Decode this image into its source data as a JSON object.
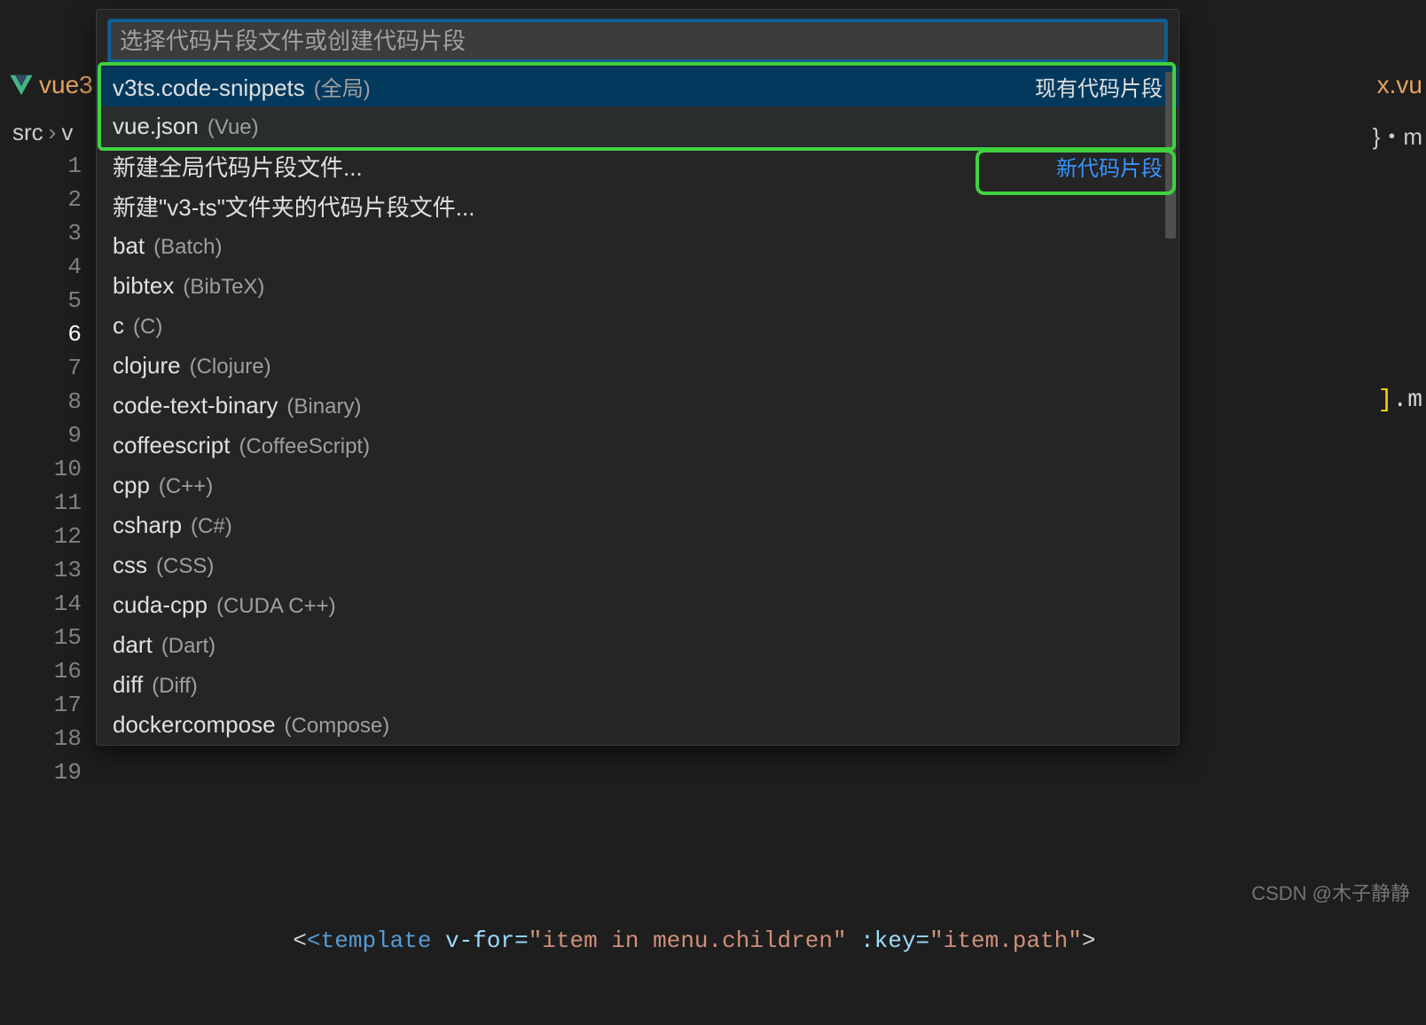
{
  "tab": {
    "label": "vue3",
    "right_label": "x.vu"
  },
  "breadcrumb": {
    "part1": "src",
    "part2": "v",
    "meta_right": "}・m"
  },
  "gutter": {
    "lines": 19,
    "active": 6
  },
  "picker": {
    "placeholder": "选择代码片段文件或创建代码片段",
    "section_existing_label": "现有代码片段",
    "section_new_label": "新代码片段",
    "items": [
      {
        "label": "v3ts.code-snippets",
        "hint": "(全局)",
        "selected": true,
        "badge": "existing"
      },
      {
        "label": "vue.json",
        "hint": "(Vue)",
        "hover": true
      },
      {
        "label": "新建全局代码片段文件...",
        "hint": "",
        "badge": "new"
      },
      {
        "label": "新建\"v3-ts\"文件夹的代码片段文件...",
        "hint": ""
      },
      {
        "label": "bat",
        "hint": "(Batch)"
      },
      {
        "label": "bibtex",
        "hint": "(BibTeX)"
      },
      {
        "label": "c",
        "hint": "(C)"
      },
      {
        "label": "clojure",
        "hint": "(Clojure)"
      },
      {
        "label": "code-text-binary",
        "hint": "(Binary)"
      },
      {
        "label": "coffeescript",
        "hint": "(CoffeeScript)"
      },
      {
        "label": "cpp",
        "hint": "(C++)"
      },
      {
        "label": "csharp",
        "hint": "(C#)"
      },
      {
        "label": "css",
        "hint": "(CSS)"
      },
      {
        "label": "cuda-cpp",
        "hint": "(CUDA C++)"
      },
      {
        "label": "dart",
        "hint": "(Dart)"
      },
      {
        "label": "diff",
        "hint": "(Diff)"
      },
      {
        "label": "dockercompose",
        "hint": "(Compose)"
      }
    ]
  },
  "code": {
    "template_open": "<template",
    "vfor": " v-for=",
    "vfor_str": "\"item in menu.children\"",
    "key": " :key=",
    "key_str": "\"item.path\"",
    "close": ">"
  },
  "bracket": "]",
  "dot_m": ".m",
  "watermark": "CSDN @木子静静"
}
